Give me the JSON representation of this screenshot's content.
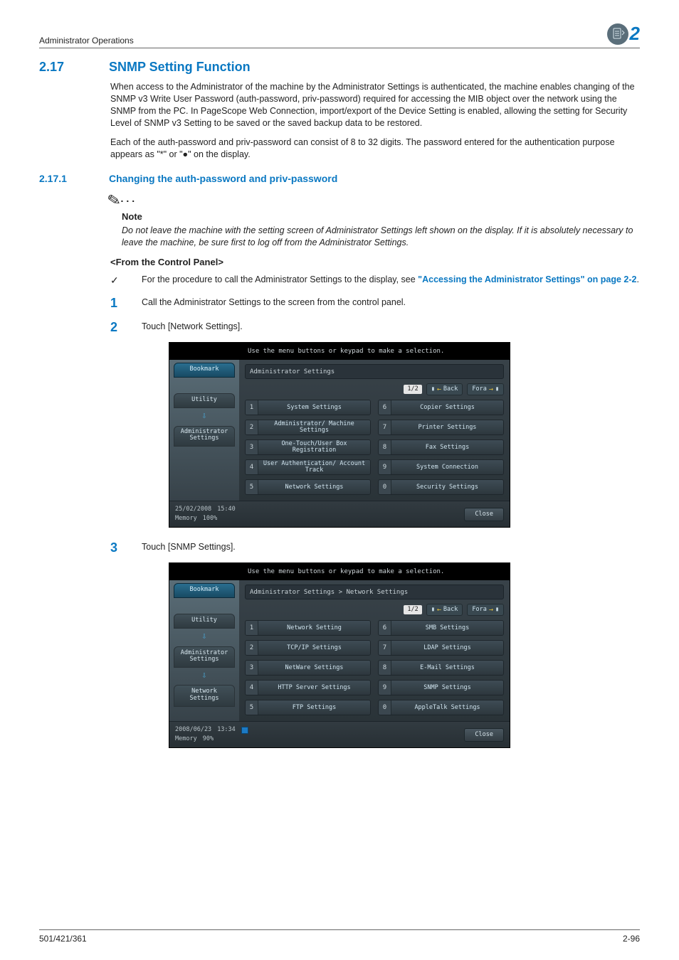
{
  "header": {
    "left": "Administrator Operations",
    "chapter": "2"
  },
  "section": {
    "number": "2.17",
    "title": "SNMP Setting Function",
    "p1": "When access to the Administrator of the machine by the Administrator Settings is authenticated, the machine enables changing of the SNMP v3 Write User Password (auth-password, priv-password) required for accessing the MIB object over the network using the SNMP from the PC. In PageScope Web Connection, import/export of the Device Setting is enabled, allowing the setting for Security Level of SNMP v3 Setting to be saved or the saved backup data to be restored.",
    "p2": "Each of the auth-password and priv-password can consist of 8 to 32 digits. The password entered for the authentication purpose appears as \"*\" or \"●\" on the display."
  },
  "subsection": {
    "number": "2.17.1",
    "title": "Changing the auth-password and priv-password"
  },
  "note": {
    "label": "Note",
    "text": "Do not leave the machine with the setting screen of Administrator Settings left shown on the display. If it is absolutely necessary to leave the machine, be sure first to log off from the Administrator Settings."
  },
  "fromPanel": "<From the Control Panel>",
  "bullet": {
    "pre": "For the procedure to call the Administrator Settings to the display, see ",
    "link": "\"Accessing the Administrator Settings\" on page 2-2",
    "post": "."
  },
  "steps": {
    "s1": {
      "num": "1",
      "text": "Call the Administrator Settings to the screen from the control panel."
    },
    "s2": {
      "num": "2",
      "text": "Touch [Network Settings]."
    },
    "s3": {
      "num": "3",
      "text": "Touch [SNMP Settings]."
    }
  },
  "panelCommon": {
    "topmsg": "Use the menu buttons or keypad to make a selection.",
    "bookmark": "Bookmark",
    "utility": "Utility",
    "admin": "Administrator Settings",
    "network": "Network Settings",
    "pager": {
      "page": "1/2",
      "back": "Back",
      "fwd": "Fora"
    },
    "close": "Close",
    "memoryLabel": "Memory"
  },
  "panel1": {
    "crumb": "Administrator Settings",
    "left": [
      {
        "n": "1",
        "l": "System Settings"
      },
      {
        "n": "2",
        "l": "Administrator/\nMachine Settings"
      },
      {
        "n": "3",
        "l": "One-Touch/User Box\nRegistration"
      },
      {
        "n": "4",
        "l": "User Authentication/\nAccount Track"
      },
      {
        "n": "5",
        "l": "Network Settings"
      }
    ],
    "right": [
      {
        "n": "6",
        "l": "Copier Settings"
      },
      {
        "n": "7",
        "l": "Printer Settings"
      },
      {
        "n": "8",
        "l": "Fax Settings"
      },
      {
        "n": "9",
        "l": "System Connection"
      },
      {
        "n": "0",
        "l": "Security Settings"
      }
    ],
    "status": {
      "date": "25/02/2008",
      "time": "15:40",
      "memory": "100%",
      "hasJobIcon": false
    }
  },
  "panel2": {
    "crumb": "Administrator Settings > Network Settings",
    "left": [
      {
        "n": "1",
        "l": "Network Setting"
      },
      {
        "n": "2",
        "l": "TCP/IP Settings"
      },
      {
        "n": "3",
        "l": "NetWare Settings"
      },
      {
        "n": "4",
        "l": "HTTP Server Settings"
      },
      {
        "n": "5",
        "l": "FTP Settings"
      }
    ],
    "right": [
      {
        "n": "6",
        "l": "SMB Settings"
      },
      {
        "n": "7",
        "l": "LDAP Settings"
      },
      {
        "n": "8",
        "l": "E-Mail Settings"
      },
      {
        "n": "9",
        "l": "SNMP Settings"
      },
      {
        "n": "0",
        "l": "AppleTalk Settings"
      }
    ],
    "status": {
      "date": "2008/06/23",
      "time": "13:34",
      "memory": "90%",
      "hasJobIcon": true
    }
  },
  "footer": {
    "left": "501/421/361",
    "right": "2-96"
  }
}
